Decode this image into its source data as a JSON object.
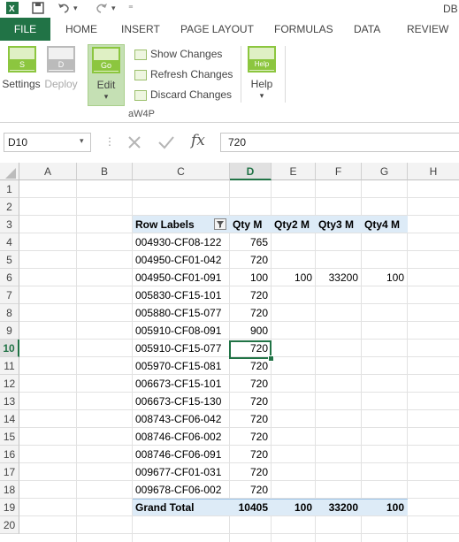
{
  "window": {
    "title_partial": "DB"
  },
  "ribbon_tabs": [
    "FILE",
    "HOME",
    "INSERT",
    "PAGE LAYOUT",
    "FORMULAS",
    "DATA",
    "REVIEW"
  ],
  "ribbon": {
    "settings": {
      "label": "Settings",
      "icon_text": "S"
    },
    "deploy": {
      "label": "Deploy",
      "icon_text": "D"
    },
    "edit": {
      "label": "Edit",
      "icon_text": "Go"
    },
    "show_changes": "Show Changes",
    "refresh_changes": "Refresh Changes",
    "discard_changes": "Discard Changes",
    "help": {
      "label": "Help",
      "icon_text": "Help"
    },
    "group_label": "aW4P"
  },
  "formula_bar": {
    "name_box": "D10",
    "fx": "fx",
    "value": "720"
  },
  "columns": [
    "A",
    "B",
    "C",
    "D",
    "E",
    "F",
    "G",
    "H"
  ],
  "rows": [
    "1",
    "2",
    "3",
    "4",
    "5",
    "6",
    "7",
    "8",
    "9",
    "10",
    "11",
    "12",
    "13",
    "14",
    "15",
    "16",
    "17",
    "18",
    "19",
    "20"
  ],
  "selected": {
    "column": "D",
    "row": "10"
  },
  "pivot": {
    "headers": [
      "Row Labels",
      "Qty M",
      "Qty2 M",
      "Qty3 M",
      "Qty4 M"
    ],
    "rows": [
      {
        "label": "004930-CF08-122",
        "qty": "765",
        "qty2": "",
        "qty3": "",
        "qty4": ""
      },
      {
        "label": "004950-CF01-042",
        "qty": "720",
        "qty2": "",
        "qty3": "",
        "qty4": ""
      },
      {
        "label": "004950-CF01-091",
        "qty": "100",
        "qty2": "100",
        "qty3": "33200",
        "qty4": "100"
      },
      {
        "label": "005830-CF15-101",
        "qty": "720",
        "qty2": "",
        "qty3": "",
        "qty4": ""
      },
      {
        "label": "005880-CF15-077",
        "qty": "720",
        "qty2": "",
        "qty3": "",
        "qty4": ""
      },
      {
        "label": "005910-CF08-091",
        "qty": "900",
        "qty2": "",
        "qty3": "",
        "qty4": ""
      },
      {
        "label": "005910-CF15-077",
        "qty": "720",
        "qty2": "",
        "qty3": "",
        "qty4": ""
      },
      {
        "label": "005970-CF15-081",
        "qty": "720",
        "qty2": "",
        "qty3": "",
        "qty4": ""
      },
      {
        "label": "006673-CF15-101",
        "qty": "720",
        "qty2": "",
        "qty3": "",
        "qty4": ""
      },
      {
        "label": "006673-CF15-130",
        "qty": "720",
        "qty2": "",
        "qty3": "",
        "qty4": ""
      },
      {
        "label": "008743-CF06-042",
        "qty": "720",
        "qty2": "",
        "qty3": "",
        "qty4": ""
      },
      {
        "label": "008746-CF06-002",
        "qty": "720",
        "qty2": "",
        "qty3": "",
        "qty4": ""
      },
      {
        "label": "008746-CF06-091",
        "qty": "720",
        "qty2": "",
        "qty3": "",
        "qty4": ""
      },
      {
        "label": "009677-CF01-031",
        "qty": "720",
        "qty2": "",
        "qty3": "",
        "qty4": ""
      },
      {
        "label": "009678-CF06-002",
        "qty": "720",
        "qty2": "",
        "qty3": "",
        "qty4": ""
      }
    ],
    "total": {
      "label": "Grand Total",
      "qty": "10405",
      "qty2": "100",
      "qty3": "33200",
      "qty4": "100"
    }
  },
  "colors": {
    "accent": "#217346",
    "pivot_header_bg": "#ddebf7",
    "ribbon_icon_green": "#8cc63f"
  }
}
